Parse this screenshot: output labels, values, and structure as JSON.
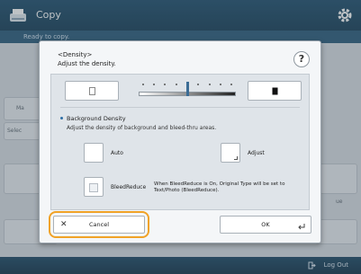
{
  "app": {
    "title": "Copy",
    "sub_header": "Ready to copy."
  },
  "background": {
    "left_labels": [
      "Ma",
      "Selec"
    ],
    "right_label": "ue"
  },
  "dialog": {
    "title_line1": "<Density>",
    "title_line2": "Adjust the density.",
    "help_label": "?",
    "density_level": 0.5,
    "background_density": {
      "title": "Background Density",
      "description": "Adjust the density of background and bleed-thru areas."
    },
    "options": {
      "auto_label": "Auto",
      "adjust_label": "Adjust",
      "bleedreduce_label": "BleedReduce",
      "bleedreduce_note": "When BleedReduce is On, Original Type will be set to Text/Photo (BleedReduce)."
    },
    "buttons": {
      "cancel_label": "Cancel",
      "ok_label": "OK"
    }
  },
  "footer": {
    "logout_label": "Log Out"
  },
  "colors": {
    "header": "#1f4f6e",
    "highlight": "#f0a227",
    "accent": "#3b6c95"
  }
}
